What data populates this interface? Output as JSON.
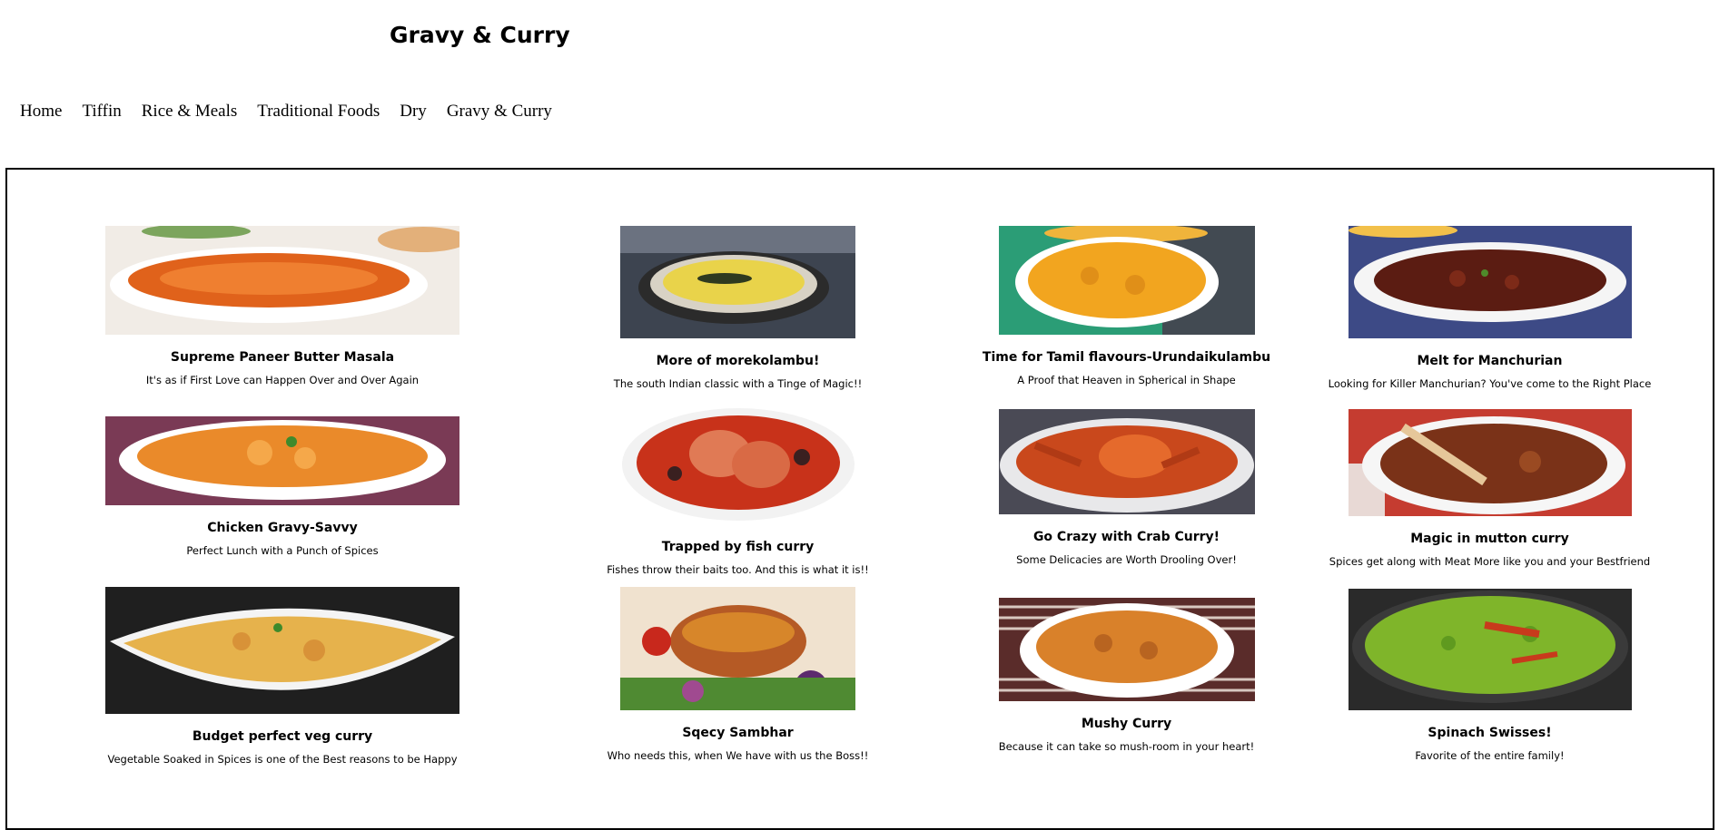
{
  "site": {
    "title": "Gravy & Curry"
  },
  "nav": [
    {
      "label": "Home"
    },
    {
      "label": "Tiffin"
    },
    {
      "label": "Rice & Meals"
    },
    {
      "label": "Traditional Foods"
    },
    {
      "label": "Dry"
    },
    {
      "label": "Gravy & Curry"
    }
  ],
  "dishes": [
    {
      "title": "Supreme Paneer Butter Masala",
      "desc": "It's as if First Love can Happen Over and Over Again"
    },
    {
      "title": "More of morekolambu!",
      "desc": "The south Indian classic with a Tinge of Magic!!"
    },
    {
      "title": "Time for Tamil flavours-Urundaikulambu",
      "desc": "A Proof that Heaven in Spherical in Shape"
    },
    {
      "title": "Melt for Manchurian",
      "desc": "Looking for Killer Manchurian? You've come to the Right Place"
    },
    {
      "title": "Chicken Gravy-Savvy",
      "desc": "Perfect Lunch with a Punch of Spices"
    },
    {
      "title": "Trapped by fish curry",
      "desc": "Fishes throw their baits too. And this is what it is!!"
    },
    {
      "title": "Go Crazy with Crab Curry!",
      "desc": "Some Delicacies are Worth Drooling Over!"
    },
    {
      "title": "Magic in mutton curry",
      "desc": "Spices get along with Meat More like you and your Bestfriend"
    },
    {
      "title": "Budget perfect veg curry",
      "desc": "Vegetable Soaked in Spices is one of the Best reasons to be Happy"
    },
    {
      "title": "Sqecy Sambhar",
      "desc": "Who needs this, when We have with us the Boss!!"
    },
    {
      "title": "Mushy Curry",
      "desc": "Because it can take so mush-room in your heart!"
    },
    {
      "title": "Spinach Swisses!",
      "desc": "Favorite of the entire family!"
    }
  ]
}
